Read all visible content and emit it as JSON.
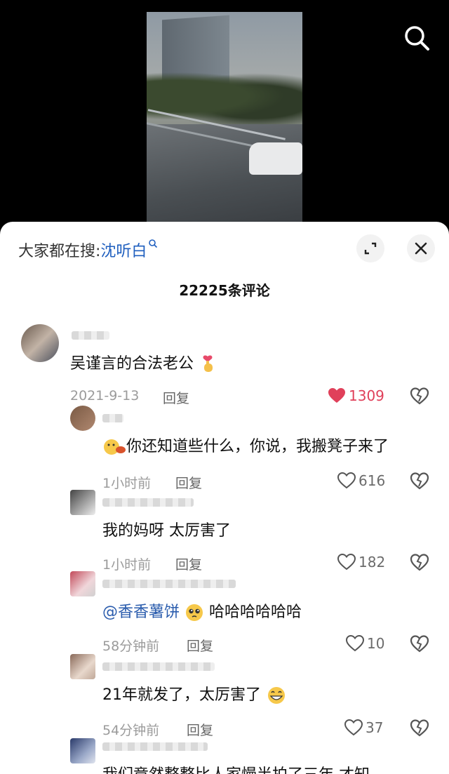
{
  "header": {
    "search_icon": "search-icon"
  },
  "sheet": {
    "hot_search_prefix": "大家都在搜:",
    "hot_search_keyword": "沈听白",
    "expand_icon": "expand-icon",
    "close_icon": "close-icon",
    "comment_count": "22225条评论"
  },
  "comments": [
    {
      "text": "吴谨言的合法老公",
      "time": "2021-9-13",
      "reply": "回复",
      "likes": "1309",
      "liked": true
    },
    {
      "text_after_emoji": "你还知道些什么，你说，我搬凳子来了",
      "time": "1小时前",
      "reply": "回复",
      "likes": "616"
    },
    {
      "text": "我的妈呀 太厉害了",
      "time": "1小时前",
      "reply": "回复",
      "likes": "182"
    },
    {
      "mention": "@香香薯饼",
      "text_after_emoji": "哈哈哈哈哈哈",
      "time": "58分钟前",
      "reply": "回复",
      "likes": "10"
    },
    {
      "text": "21年就发了，太厉害了",
      "time": "54分钟前",
      "reply": "回复",
      "likes": "37"
    },
    {
      "text": "我们竟然整整比人家慢半拍了三年 才知"
    }
  ],
  "colors": {
    "accent_like": "#e0405a",
    "link": "#1f5fbf",
    "mention": "#2a5cad"
  }
}
